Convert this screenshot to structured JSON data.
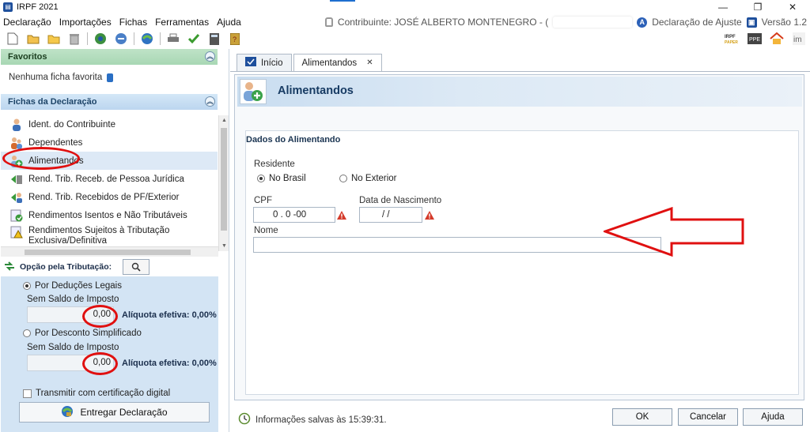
{
  "window": {
    "title": "IRPF 2021",
    "controls": [
      "—",
      "❐",
      "✕"
    ]
  },
  "menu": [
    "Declaração",
    "Importações",
    "Fichas",
    "Ferramentas",
    "Ajuda"
  ],
  "header_info": {
    "contribuinte": "Contribuinte: JOSÉ ALBERTO MONTENEGRO - (",
    "declaracao": "Declaração de Ajuste",
    "versao": "Versão 1.2"
  },
  "favoritos": {
    "title": "Favoritos",
    "empty": "Nenhuma ficha favorita"
  },
  "fichas": {
    "title": "Fichas da Declaração",
    "items": [
      "Ident. do Contribuinte",
      "Dependentes",
      "Alimentandos",
      "Rend. Trib. Receb. de Pessoa Jurídica",
      "Rend. Trib. Recebidos de PF/Exterior",
      "Rendimentos Isentos e Não Tributáveis",
      "Rendimentos Sujeitos à Tributação Exclusiva/Definitiva"
    ]
  },
  "opcao": {
    "title": "Opção pela Tributação:",
    "deducoes": "Por Deduções Legais",
    "saldo1": "Sem Saldo de Imposto",
    "valor1": "0,00",
    "aliquota1": "Alíquota efetiva: 0,00%",
    "desconto": "Por Desconto Simplificado",
    "saldo2": "Sem Saldo de Imposto",
    "valor2": "0,00",
    "aliquota2": "Alíquota efetiva: 0,00%",
    "transmitir": "Transmitir com certificação digital",
    "entregar": "Entregar Declaração"
  },
  "tabs": {
    "inicio": "Início",
    "alimentandos": "Alimentandos"
  },
  "form": {
    "banner_title": "Alimentandos",
    "section_title": "Dados do Alimentando",
    "residente_label": "Residente",
    "no_brasil": "No Brasil",
    "no_exterior": "No Exterior",
    "cpf_label": "CPF",
    "cpf_value": "0 . 0   -00",
    "nascimento_label": "Data de Nascimento",
    "nascimento_value": " /  /",
    "nome_label": "Nome",
    "nome_value": ""
  },
  "status": {
    "message": "Informações salvas às 15:39:31."
  },
  "buttons": {
    "ok": "OK",
    "cancelar": "Cancelar",
    "ajuda": "Ajuda"
  },
  "colors": {
    "annotation_red": "#e01010",
    "accent_blue": "#1e4f9c",
    "selected_row": "#dde9f6"
  }
}
